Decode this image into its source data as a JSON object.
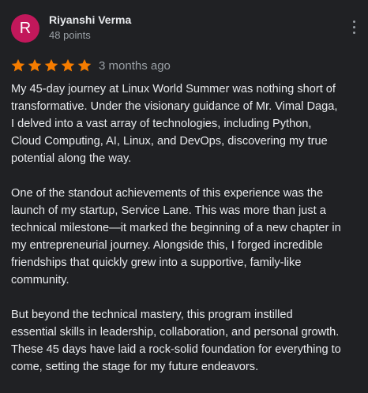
{
  "reviewer": {
    "initial": "R",
    "name": "Riyanshi Verma",
    "points": "48 points",
    "avatar_color": "#c2185b"
  },
  "rating": {
    "stars": 5,
    "max_stars": 5,
    "star_color": "#f57c00",
    "time_ago": "3 months ago"
  },
  "menu": {
    "icon": "more-vert-icon"
  },
  "review": {
    "paragraphs": [
      "My 45-day journey at Linux World Summer was nothing short of\ntransformative. Under the visionary guidance of Mr. Vimal Daga,\nI delved into a vast array of technologies, including Python,\nCloud Computing, AI, Linux, and DevOps, discovering my true\npotential along the way.",
      "One of the standout achievements of this experience was the\nlaunch of my startup, Service Lane. This was more than just a\ntechnical milestone—it marked the beginning of a new chapter in\nmy entrepreneurial journey. Alongside this, I forged incredible\nfriendships that quickly grew into a supportive, family-like\ncommunity.",
      "But beyond the technical mastery, this program instilled\nessential skills in leadership, collaboration, and personal growth.\nThese 45 days have laid a rock-solid foundation for everything to\ncome, setting the stage for my future endeavors."
    ]
  }
}
